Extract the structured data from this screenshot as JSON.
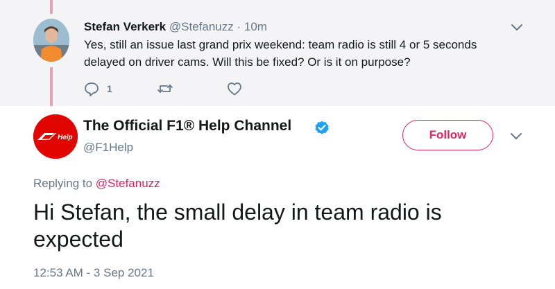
{
  "parent_tweet": {
    "author_name": "Stefan Verkerk",
    "author_handle": "@Stefanuzz",
    "separator": "·",
    "time": "10m",
    "text": "Yes, still an issue last grand prix weekend: team radio is still 4 or 5 seconds delayed on driver cams. Will this be fixed? Or is it on purpose?",
    "reply_count": "1",
    "icons": [
      "reply-icon",
      "retweet-icon",
      "like-icon",
      "chevron-down-icon"
    ]
  },
  "main_tweet": {
    "author_name": "The Official F1® Help Channel",
    "author_handle": "@F1Help",
    "follow_label": "Follow",
    "avatar_text": "Help",
    "replying_prefix": "Replying to",
    "replying_to": "@Stefanuzz",
    "text": "Hi Stefan, the small delay in team radio is expected",
    "timestamp": "12:53 AM - 3 Sep 2021",
    "icons": [
      "verified-icon",
      "chevron-down-icon",
      "f1-logo-icon"
    ]
  },
  "colors": {
    "accent": "#e0245e",
    "f1_red": "#e10600",
    "muted": "#657786",
    "verified": "#1da1f2",
    "parent_bg": "#f4f4f6",
    "thread_line": "#e3a4b0"
  }
}
